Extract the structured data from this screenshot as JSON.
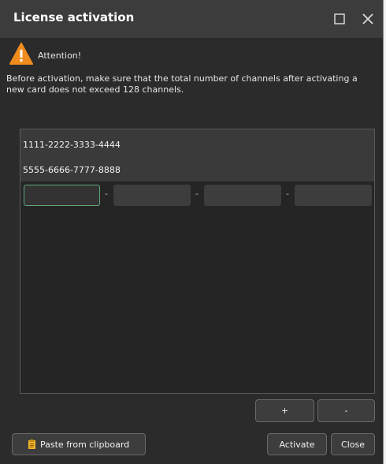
{
  "window": {
    "title": "License activation",
    "maximize_icon": "maximize-icon",
    "close_icon": "close-icon"
  },
  "warning": {
    "icon": "warning-icon",
    "label": "Attention!",
    "message": "Before activation, make sure that the total number of channels after activating a new card does not exceed 128 channels."
  },
  "keys": {
    "items": [
      "1111-2222-3333-4444",
      "5555-6666-7777-8888"
    ],
    "input_segments": [
      "",
      "",
      "",
      ""
    ],
    "separator": "-"
  },
  "buttons": {
    "add": "+",
    "remove": "-",
    "paste": "Paste from clipboard",
    "paste_icon": "clipboard-icon",
    "activate": "Activate",
    "close": "Close"
  },
  "colors": {
    "background": "#2b2b2b",
    "titlebar": "#3c3c3c",
    "warning": "#f08c1e",
    "active_border": "#5fa878"
  }
}
